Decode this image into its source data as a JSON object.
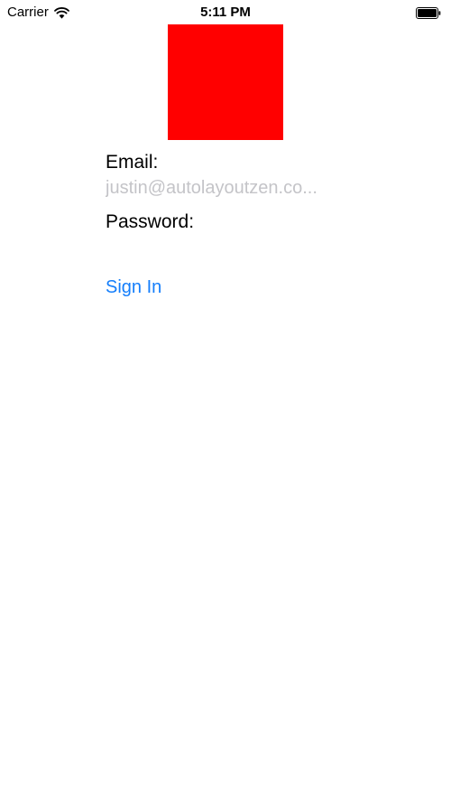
{
  "status_bar": {
    "carrier": "Carrier",
    "time": "5:11 PM",
    "icons": [
      "wifi-icon",
      "battery-icon"
    ]
  },
  "logo": {
    "color": "#ff0000"
  },
  "form": {
    "email_label": "Email:",
    "email_value": "",
    "email_placeholder": "justin@autolayoutzen.co...",
    "password_label": "Password:",
    "password_value": "",
    "password_placeholder": ""
  },
  "sign_in_label": "Sign In",
  "colors": {
    "accent": "#147efb",
    "placeholder": "#c4c4c8",
    "background": "#ffffff"
  }
}
